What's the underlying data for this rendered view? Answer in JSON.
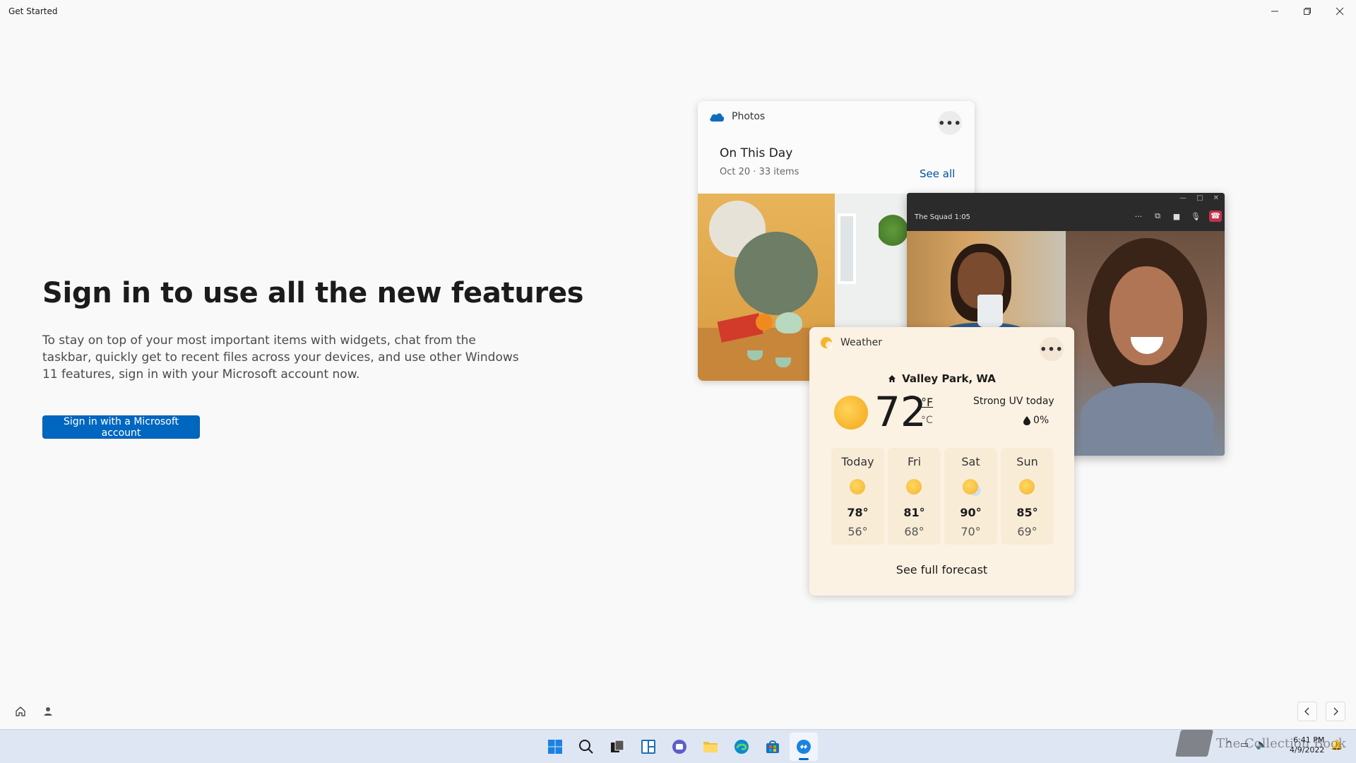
{
  "window": {
    "title": "Get Started",
    "controls": [
      "minimize",
      "restore",
      "close"
    ]
  },
  "main": {
    "headline": "Sign in to use all the new features",
    "description": "To stay on top of your most important items with widgets, chat from the taskbar, quickly get to recent files across your devices, and use other Windows 11 features, sign in with your Microsoft account now.",
    "signin_button": "Sign in with a Microsoft account"
  },
  "photos_card": {
    "app_name": "Photos",
    "more": "•••",
    "title": "On This Day",
    "meta": "Oct 20  · 33 items",
    "see_all": "See all"
  },
  "call_window": {
    "title": "The Squad 1:05",
    "controls": [
      "more-icon",
      "share-icon",
      "camera-icon",
      "mic-icon",
      "hangup-icon"
    ]
  },
  "weather_card": {
    "app_name": "Weather",
    "more": "•••",
    "location": "Valley Park, WA",
    "temperature": "72",
    "unit_f": "°F",
    "unit_c": "°C",
    "uv": "Strong UV today",
    "precip": "0%",
    "forecast": [
      {
        "day": "Today",
        "hi": "78°",
        "lo": "56°",
        "icon": "sunny-icon"
      },
      {
        "day": "Fri",
        "hi": "81°",
        "lo": "68°",
        "icon": "sunny-icon"
      },
      {
        "day": "Sat",
        "hi": "90°",
        "lo": "70°",
        "icon": "partly-sunny-icon"
      },
      {
        "day": "Sun",
        "hi": "85°",
        "lo": "69°",
        "icon": "sunny-icon"
      }
    ],
    "full_forecast": "See full forecast"
  },
  "taskbar": {
    "apps": [
      "start-icon",
      "search-icon",
      "task-view-icon",
      "widgets-icon",
      "teams-chat-icon",
      "file-explorer-icon",
      "edge-icon",
      "store-icon",
      "get-started-icon"
    ],
    "clock_time": "6:41 PM",
    "clock_date": "4/9/2022",
    "watermark": "The Collection Book"
  },
  "colors": {
    "accent": "#0067c0",
    "weather_bg": "#fcf2e3",
    "taskbar_bg": "#dfe6f3"
  }
}
